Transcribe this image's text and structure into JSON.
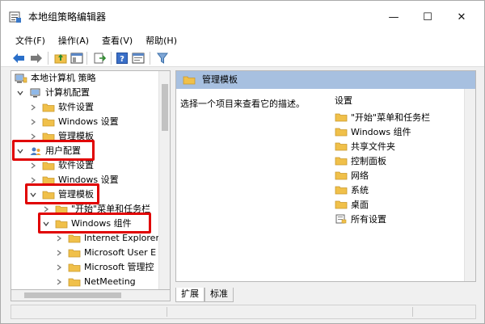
{
  "window": {
    "title": "本地组策略编辑器",
    "controls": {
      "minimize": "—",
      "maximize": "☐",
      "close": "✕"
    }
  },
  "menu": [
    "文件(F)",
    "操作(A)",
    "查看(V)",
    "帮助(H)"
  ],
  "toolbar": {
    "icons": [
      "back-arrow-icon",
      "forward-arrow-icon",
      "up-folder-icon",
      "show-hide-tree-icon",
      "export-list-icon",
      "help-icon",
      "properties-icon",
      "filter-icon"
    ]
  },
  "tree": {
    "root": "本地计算机 策略",
    "computer_config": "计算机配置",
    "software_settings_1": "软件设置",
    "windows_settings_1": "Windows 设置",
    "admin_templates_1": "管理模板",
    "user_config": "用户配置",
    "software_settings_2": "软件设置",
    "windows_settings_2": "Windows 设置",
    "admin_templates_2": "管理模板",
    "start_menu": "\"开始\"菜单和任务栏",
    "windows_components": "Windows 组件",
    "ie": "Internet Explorer",
    "user_exp": "Microsoft User E",
    "mgmt": "Microsoft 管理控",
    "netmeeting": "NetMeeting"
  },
  "right": {
    "header": "管理模板",
    "description": "选择一个项目来查看它的描述。",
    "list_header": "设置",
    "items": [
      "\"开始\"菜单和任务栏",
      "Windows 组件",
      "共享文件夹",
      "控制面板",
      "网络",
      "系统",
      "桌面",
      "所有设置"
    ]
  },
  "tabs": [
    "扩展",
    "标准"
  ],
  "colors": {
    "accent_header": "#a7c0e0",
    "highlight": "#e00000",
    "folder": "#f0c04a"
  }
}
